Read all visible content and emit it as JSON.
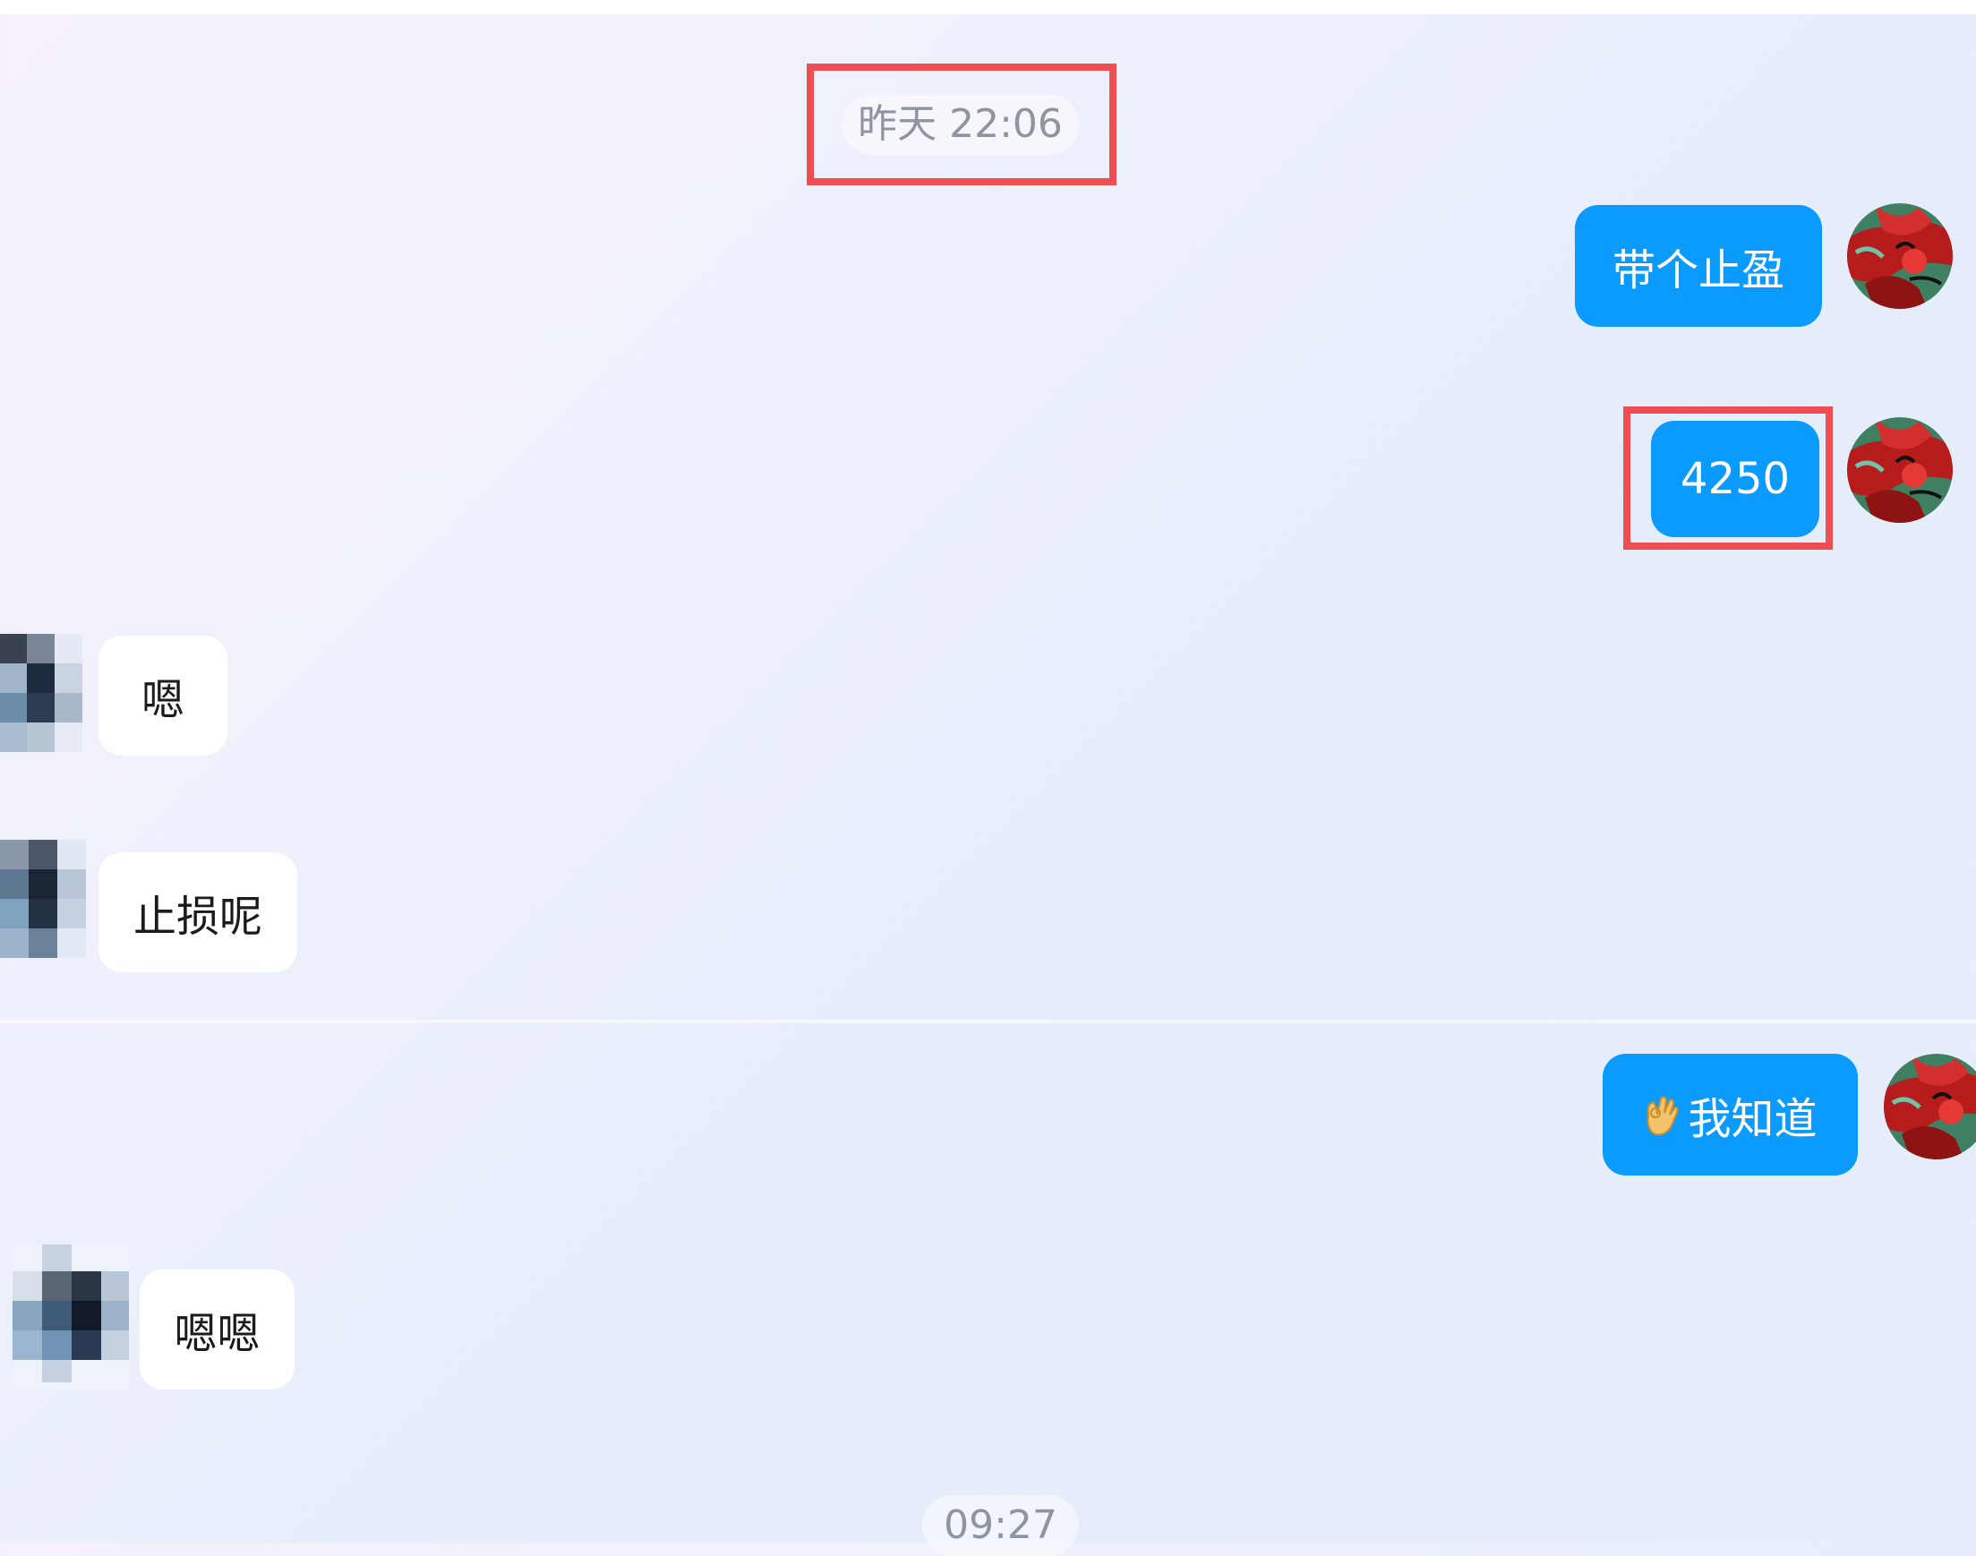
{
  "chat": {
    "timestamps": [
      "昨天 22:06",
      "09:27"
    ],
    "messages": [
      {
        "side": "out",
        "text": "带个止盈"
      },
      {
        "side": "out",
        "text": "4250"
      },
      {
        "side": "in",
        "text": "嗯"
      },
      {
        "side": "in",
        "text": "止损呢"
      },
      {
        "side": "out",
        "text": "我知道",
        "icon": "ok-hand-icon"
      },
      {
        "side": "in",
        "text": "嗯嗯"
      }
    ]
  },
  "colors": {
    "outgoing_bubble": "#0b9bff",
    "incoming_bubble": "#ffffff",
    "highlight": "#ee4e52",
    "timestamp_text": "#8f959e"
  }
}
